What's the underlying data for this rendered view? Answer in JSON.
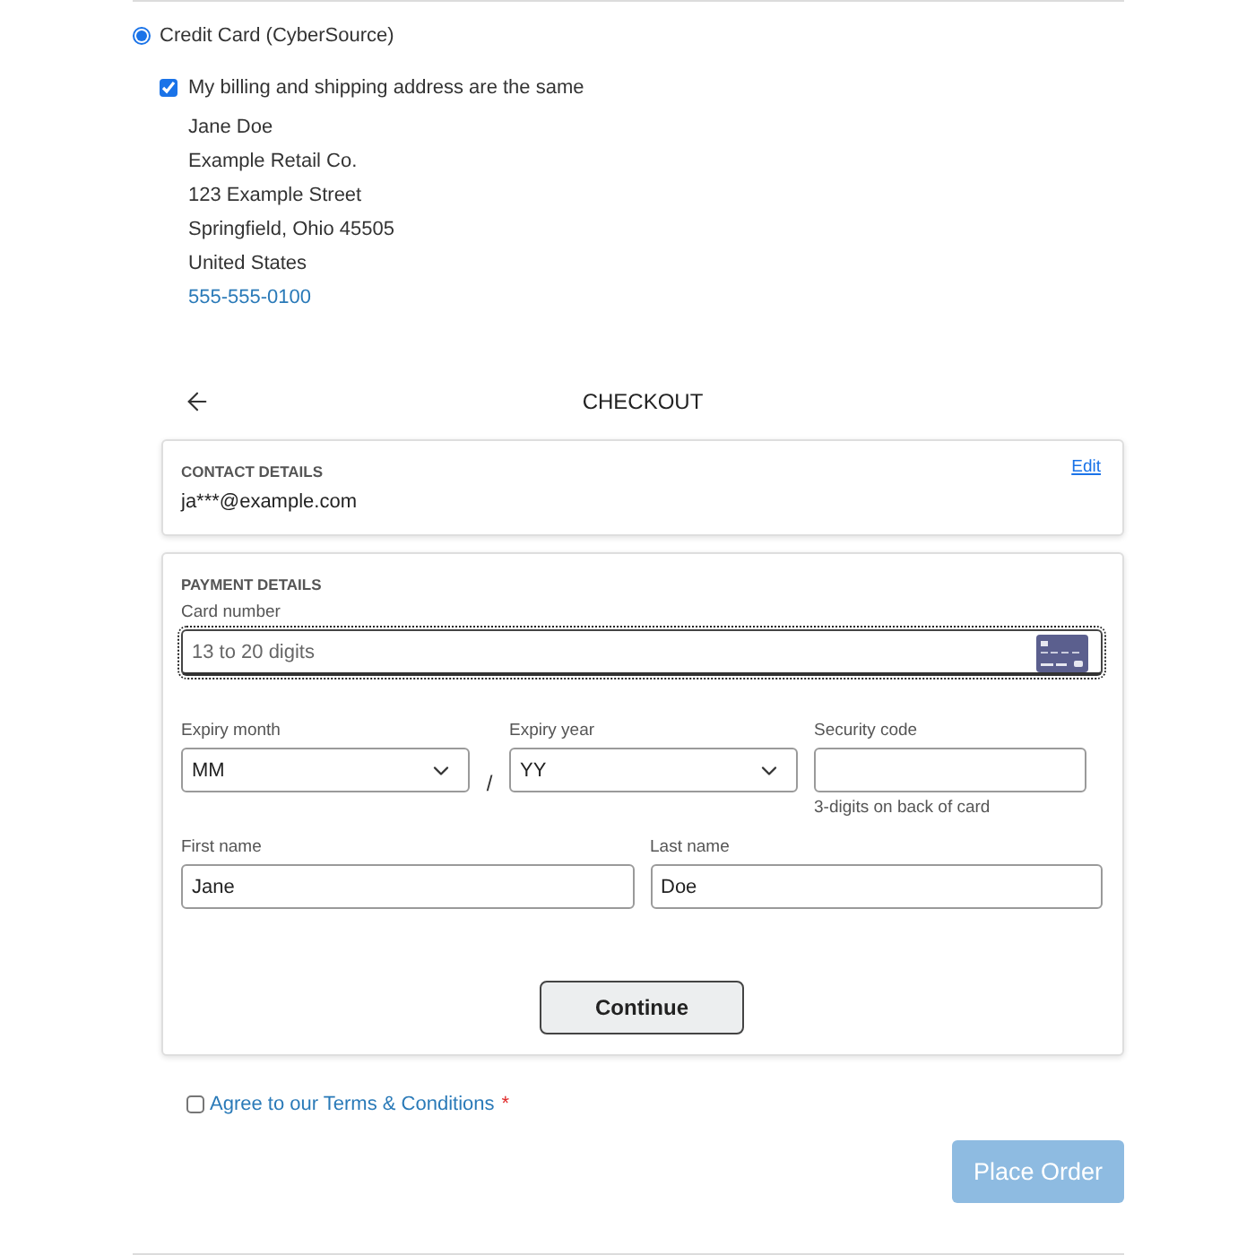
{
  "payment_method": {
    "label": "Credit Card (CyberSource)",
    "selected": true
  },
  "same_address": {
    "label": "My billing and shipping address are the same",
    "checked": true
  },
  "address": {
    "lines": [
      "Jane Doe",
      "Example Retail Co.",
      "123 Example Street",
      "Springfield, Ohio 45505",
      "United States"
    ],
    "phone": "555-555-0100"
  },
  "checkout": {
    "title": "CHECKOUT",
    "contact": {
      "heading": "CONTACT DETAILS",
      "edit": "Edit",
      "email": "ja***@example.com"
    },
    "payment": {
      "heading": "PAYMENT DETAILS",
      "card_number": {
        "label": "Card number",
        "placeholder": "13 to 20 digits",
        "focused": true
      },
      "expiry_month": {
        "label": "Expiry month",
        "value": "MM"
      },
      "separator": "/",
      "expiry_year": {
        "label": "Expiry year",
        "value": "YY"
      },
      "security_code": {
        "label": "Security code",
        "hint": "3-digits on back of card"
      },
      "first_name": {
        "label": "First name",
        "value": "Jane"
      },
      "last_name": {
        "label": "Last name",
        "value": "Doe"
      },
      "continue": "Continue"
    }
  },
  "terms": {
    "label": "Agree to our Terms & Conditions",
    "required_mark": "*",
    "checked": false
  },
  "place_order": {
    "label": "Place Order",
    "disabled": true
  }
}
